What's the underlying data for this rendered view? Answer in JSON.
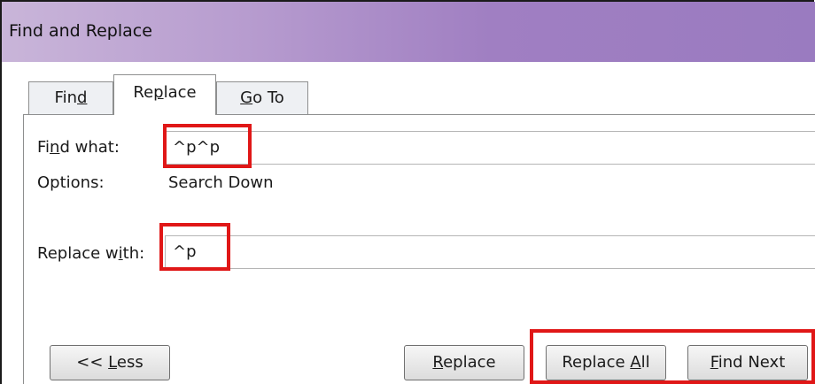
{
  "window": {
    "title": "Find and Replace"
  },
  "tabs": [
    {
      "label": "Find",
      "access_key": "d",
      "selected": false
    },
    {
      "label": "Replace",
      "access_key": "p",
      "selected": true
    },
    {
      "label": "Go To",
      "access_key": "G",
      "selected": false
    }
  ],
  "find": {
    "label": "Find what:",
    "access_key": "i",
    "value": "^p^p"
  },
  "options": {
    "label": "Options:",
    "value": "Search Down"
  },
  "replace": {
    "label": "Replace with:",
    "access_key": "i",
    "value": "^p"
  },
  "buttons": {
    "less": "<< Less",
    "replace": "Replace",
    "replace_all": "Replace All",
    "find_next": "Find Next"
  },
  "highlight_color": "#e01717"
}
